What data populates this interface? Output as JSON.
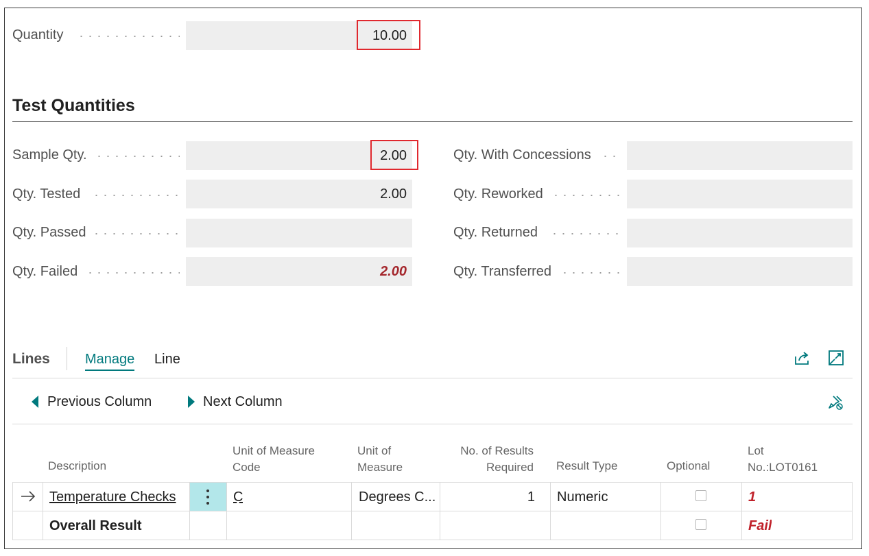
{
  "general": {
    "quantity_label": "Quantity",
    "quantity_value": "10.00"
  },
  "test_quantities": {
    "title": "Test Quantities",
    "sample_qty_label": "Sample Qty.",
    "sample_qty_value": "2.00",
    "qty_tested_label": "Qty. Tested",
    "qty_tested_value": "2.00",
    "qty_passed_label": "Qty. Passed",
    "qty_passed_value": "",
    "qty_failed_label": "Qty. Failed",
    "qty_failed_value": "2.00",
    "qty_concessions_label": "Qty. With Concessions",
    "qty_concessions_value": "",
    "qty_reworked_label": "Qty. Reworked",
    "qty_reworked_value": "",
    "qty_returned_label": "Qty. Returned",
    "qty_returned_value": "",
    "qty_transferred_label": "Qty. Transferred",
    "qty_transferred_value": ""
  },
  "lines": {
    "title": "Lines",
    "tabs": [
      "Manage",
      "Line"
    ],
    "actions": {
      "previous_column": "Previous Column",
      "next_column": "Next Column"
    },
    "columns": {
      "description": "Description",
      "uom_code_1": "Unit of Measure",
      "uom_code_2": "Code",
      "uom_1": "Unit of",
      "uom_2": "Measure",
      "results_required_1": "No. of Results",
      "results_required_2": "Required",
      "result_type": "Result Type",
      "optional": "Optional",
      "lot_1": "Lot",
      "lot_2": "No.:LOT0161"
    },
    "rows": [
      {
        "description": "Temperature Checks",
        "uom_code": "C",
        "uom": "Degrees C...",
        "results_required": "1",
        "result_type": "Numeric",
        "optional": false,
        "lot_value": "1"
      },
      {
        "description": "Overall Result",
        "uom_code": "",
        "uom": "",
        "results_required": "",
        "result_type": "",
        "optional": false,
        "lot_value": "Fail"
      }
    ]
  },
  "colors": {
    "accent": "#00797d",
    "fail": "#c0212a",
    "highlight": "#e0282e",
    "field_bg": "#eeeeee"
  }
}
